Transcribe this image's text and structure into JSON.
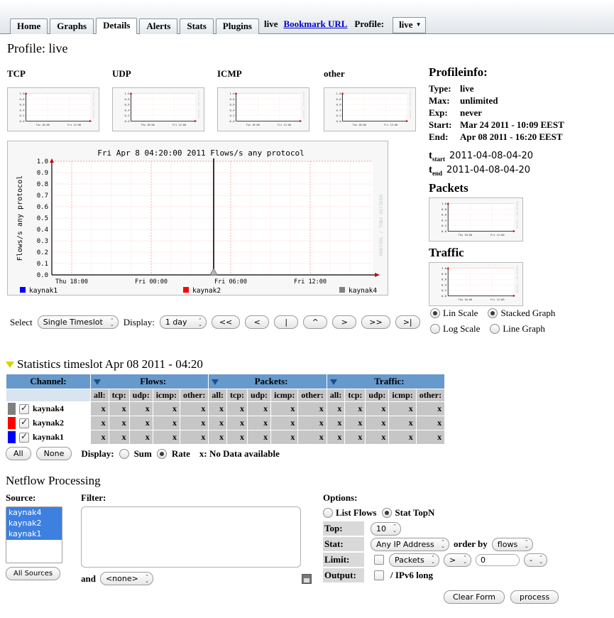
{
  "topbar": {
    "tabs": [
      {
        "label": "Home",
        "active": false
      },
      {
        "label": "Graphs",
        "active": false
      },
      {
        "label": "Details",
        "active": true
      },
      {
        "label": "Alerts",
        "active": false
      },
      {
        "label": "Stats",
        "active": false
      },
      {
        "label": "Plugins",
        "active": false
      }
    ],
    "live_text": "live",
    "bookmark_label": "Bookmark URL",
    "profile_label": "Profile:",
    "profile_value": "live"
  },
  "page_title": "Profile: live",
  "mini_graphs": [
    {
      "label": "TCP"
    },
    {
      "label": "UDP"
    },
    {
      "label": "ICMP"
    },
    {
      "label": "other"
    }
  ],
  "chart_data": {
    "type": "line",
    "title": "Fri Apr  8 04:20:00 2011 Flows/s any protocol",
    "ylabel": "Flows/s any protocol",
    "xlabel": "",
    "ylim": [
      0.0,
      1.0
    ],
    "yticks": [
      "0.0",
      "0.1",
      "0.2",
      "0.3",
      "0.4",
      "0.5",
      "0.6",
      "0.7",
      "0.8",
      "0.9",
      "1.0"
    ],
    "xticks": [
      "Thu 18:00",
      "Fri 00:00",
      "Fri 06:00",
      "Fri 12:00"
    ],
    "grid": true,
    "watermark": "RRDTOOL / TOBI OETIKER",
    "legend_position": "bottom",
    "legend": [
      {
        "name": "kaynak1",
        "color": "#0000ff"
      },
      {
        "name": "kaynak2",
        "color": "#ff0000"
      },
      {
        "name": "kaynak4",
        "color": "#808080"
      }
    ],
    "series": [
      {
        "name": "kaynak1",
        "color": "#0000ff",
        "values": []
      },
      {
        "name": "kaynak2",
        "color": "#ff0000",
        "values": []
      },
      {
        "name": "kaynak4",
        "color": "#808080",
        "values": [
          0.03
        ]
      }
    ],
    "cursor": {
      "x_label": "Fri 04:20",
      "marker_value": 0.03
    },
    "notes": "No data plotted; single cursor line at selected timeslot"
  },
  "mini_chart_data": {
    "type": "line",
    "ylim": [
      0.0,
      1.0
    ],
    "yticks": [
      "1.0",
      "0.8",
      "0.6",
      "0.4",
      "0.2",
      "0.0"
    ],
    "xticks": [
      "Thu 18:00",
      "Fri 12:00"
    ],
    "values": []
  },
  "nav": {
    "select_label": "Select",
    "select_value": "Single Timeslot",
    "select_options": [
      "Single Timeslot"
    ],
    "display_label": "Display:",
    "display_value": "1 day",
    "display_options": [
      "1 day"
    ],
    "buttons": [
      "<<",
      "<",
      "|",
      "^",
      ">",
      ">>",
      ">|"
    ]
  },
  "profileinfo": {
    "heading": "Profileinfo:",
    "rows": [
      {
        "key": "Type:",
        "value": "live"
      },
      {
        "key": "Max:",
        "value": "unlimited"
      },
      {
        "key": "Exp:",
        "value": "never"
      },
      {
        "key": "Start:",
        "value": "Mar 24 2011 - 10:09 EEST"
      },
      {
        "key": "End:",
        "value": "Apr 08 2011 - 16:20 EEST"
      }
    ],
    "t_start_label": "t",
    "t_start_sub": "start",
    "t_start_value": "2011-04-08-04-20",
    "t_end_label": "t",
    "t_end_sub": "end",
    "t_end_value": "2011-04-08-04-20",
    "packets_heading": "Packets",
    "traffic_heading": "Traffic"
  },
  "scale_options": {
    "lin_scale": "Lin Scale",
    "log_scale": "Log Scale",
    "stacked_graph": "Stacked Graph",
    "line_graph": "Line Graph",
    "lin_selected": true,
    "log_selected": false,
    "stacked_selected": true,
    "line_selected": false
  },
  "statistics": {
    "title": "Statistics timeslot Apr 08 2011 - 04:20",
    "channel_header": "Channel:",
    "groups": [
      "Flows:",
      "Packets:",
      "Traffic:"
    ],
    "sub_headers": [
      "all:",
      "tcp:",
      "udp:",
      "icmp:",
      "other:"
    ],
    "rows": [
      {
        "name": "kaynak4",
        "color": "#808080",
        "checked": true,
        "cells": [
          "x",
          "x",
          "x",
          "x",
          "x",
          "x",
          "x",
          "x",
          "x",
          "x",
          "x",
          "x",
          "x",
          "x",
          "x"
        ]
      },
      {
        "name": "kaynak2",
        "color": "#ff0000",
        "checked": true,
        "cells": [
          "x",
          "x",
          "x",
          "x",
          "x",
          "x",
          "x",
          "x",
          "x",
          "x",
          "x",
          "x",
          "x",
          "x",
          "x"
        ]
      },
      {
        "name": "kaynak1",
        "color": "#0000ff",
        "checked": true,
        "cells": [
          "x",
          "x",
          "x",
          "x",
          "x",
          "x",
          "x",
          "x",
          "x",
          "x",
          "x",
          "x",
          "x",
          "x",
          "x"
        ]
      }
    ],
    "all_button": "All",
    "none_button": "None",
    "display_label": "Display:",
    "sum_label": "Sum",
    "rate_label": "Rate",
    "sum_selected": false,
    "rate_selected": true,
    "legend_note": "x: No Data available"
  },
  "netflow": {
    "heading": "Netflow Processing",
    "source_label": "Source:",
    "sources": [
      "kaynak4",
      "kaynak2",
      "kaynak1"
    ],
    "all_sources_button": "All Sources",
    "filter_label": "Filter:",
    "filter_value": "",
    "and_label": "and",
    "and_value": "<none>",
    "and_options": [
      "<none>"
    ],
    "options_label": "Options:",
    "list_flows_label": "List Flows",
    "stat_topn_label": "Stat TopN",
    "list_flows_selected": false,
    "stat_topn_selected": true,
    "top_label": "Top:",
    "top_value": "10",
    "top_options": [
      "10"
    ],
    "stat_label": "Stat:",
    "stat_value": "Any IP Address",
    "stat_options": [
      "Any IP Address"
    ],
    "order_by_label": "order by",
    "order_by_value": "flows",
    "order_by_options": [
      "flows"
    ],
    "limit_label": "Limit:",
    "limit_checked": false,
    "limit_metric": "Packets",
    "limit_metric_options": [
      "Packets"
    ],
    "limit_op": ">",
    "limit_op_options": [
      ">"
    ],
    "limit_value": "0",
    "limit_unit": "-",
    "limit_unit_options": [
      "-"
    ],
    "output_label": "Output:",
    "output_checked": false,
    "output_text": "/ IPv6 long",
    "clear_form_button": "Clear Form",
    "process_button": "process"
  }
}
